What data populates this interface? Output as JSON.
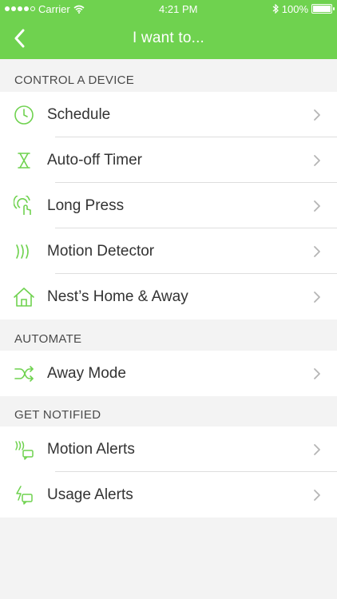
{
  "status_bar": {
    "carrier": "Carrier",
    "time": "4:21 PM",
    "battery": "100%"
  },
  "nav": {
    "title": "I want to..."
  },
  "sections": {
    "control": {
      "header": "CONTROL A DEVICE",
      "items": [
        {
          "label": "Schedule",
          "icon": "clock-icon"
        },
        {
          "label": "Auto-off Timer",
          "icon": "hourglass-icon"
        },
        {
          "label": "Long Press",
          "icon": "long-press-icon"
        },
        {
          "label": "Motion Detector",
          "icon": "motion-waves-icon"
        },
        {
          "label": "Nest’s Home & Away",
          "icon": "home-icon"
        }
      ]
    },
    "automate": {
      "header": "AUTOMATE",
      "items": [
        {
          "label": "Away Mode",
          "icon": "shuffle-icon"
        }
      ]
    },
    "notified": {
      "header": "GET NOTIFIED",
      "items": [
        {
          "label": "Motion Alerts",
          "icon": "motion-alert-icon"
        },
        {
          "label": "Usage Alerts",
          "icon": "usage-alert-icon"
        }
      ]
    }
  },
  "colors": {
    "accent": "#6fd24f",
    "icon": "#6fd24f",
    "chevron": "#b5b5b5"
  }
}
